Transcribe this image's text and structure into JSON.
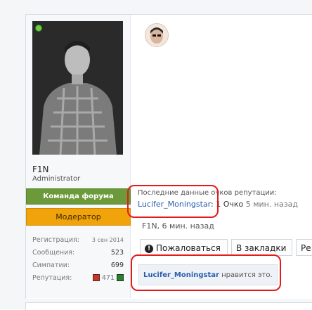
{
  "user": {
    "name": "F1N",
    "title": "Administrator",
    "banners": [
      "Команда форума",
      "Модератор"
    ],
    "stats": [
      {
        "label": "Регистрация:",
        "value": "3 сен 2014"
      },
      {
        "label": "Сообщения:",
        "value": "523"
      },
      {
        "label": "Симпатии:",
        "value": "699"
      }
    ],
    "reputation": {
      "label": "Репутация:",
      "value": "471"
    }
  },
  "reputation_info": {
    "caption": "Последние данные очков репутации:",
    "user": "Lucifer_Moningstar",
    "points": ": 1 Очко",
    "time": "5 мин. назад"
  },
  "last_edit": "F1N, 6 мин. назад",
  "actions": {
    "report": "Пожаловаться",
    "bookmark": "В закладки",
    "more": "Ре"
  },
  "likes": {
    "user": "Lucifer_Moningstar",
    "text": " нравится это."
  }
}
